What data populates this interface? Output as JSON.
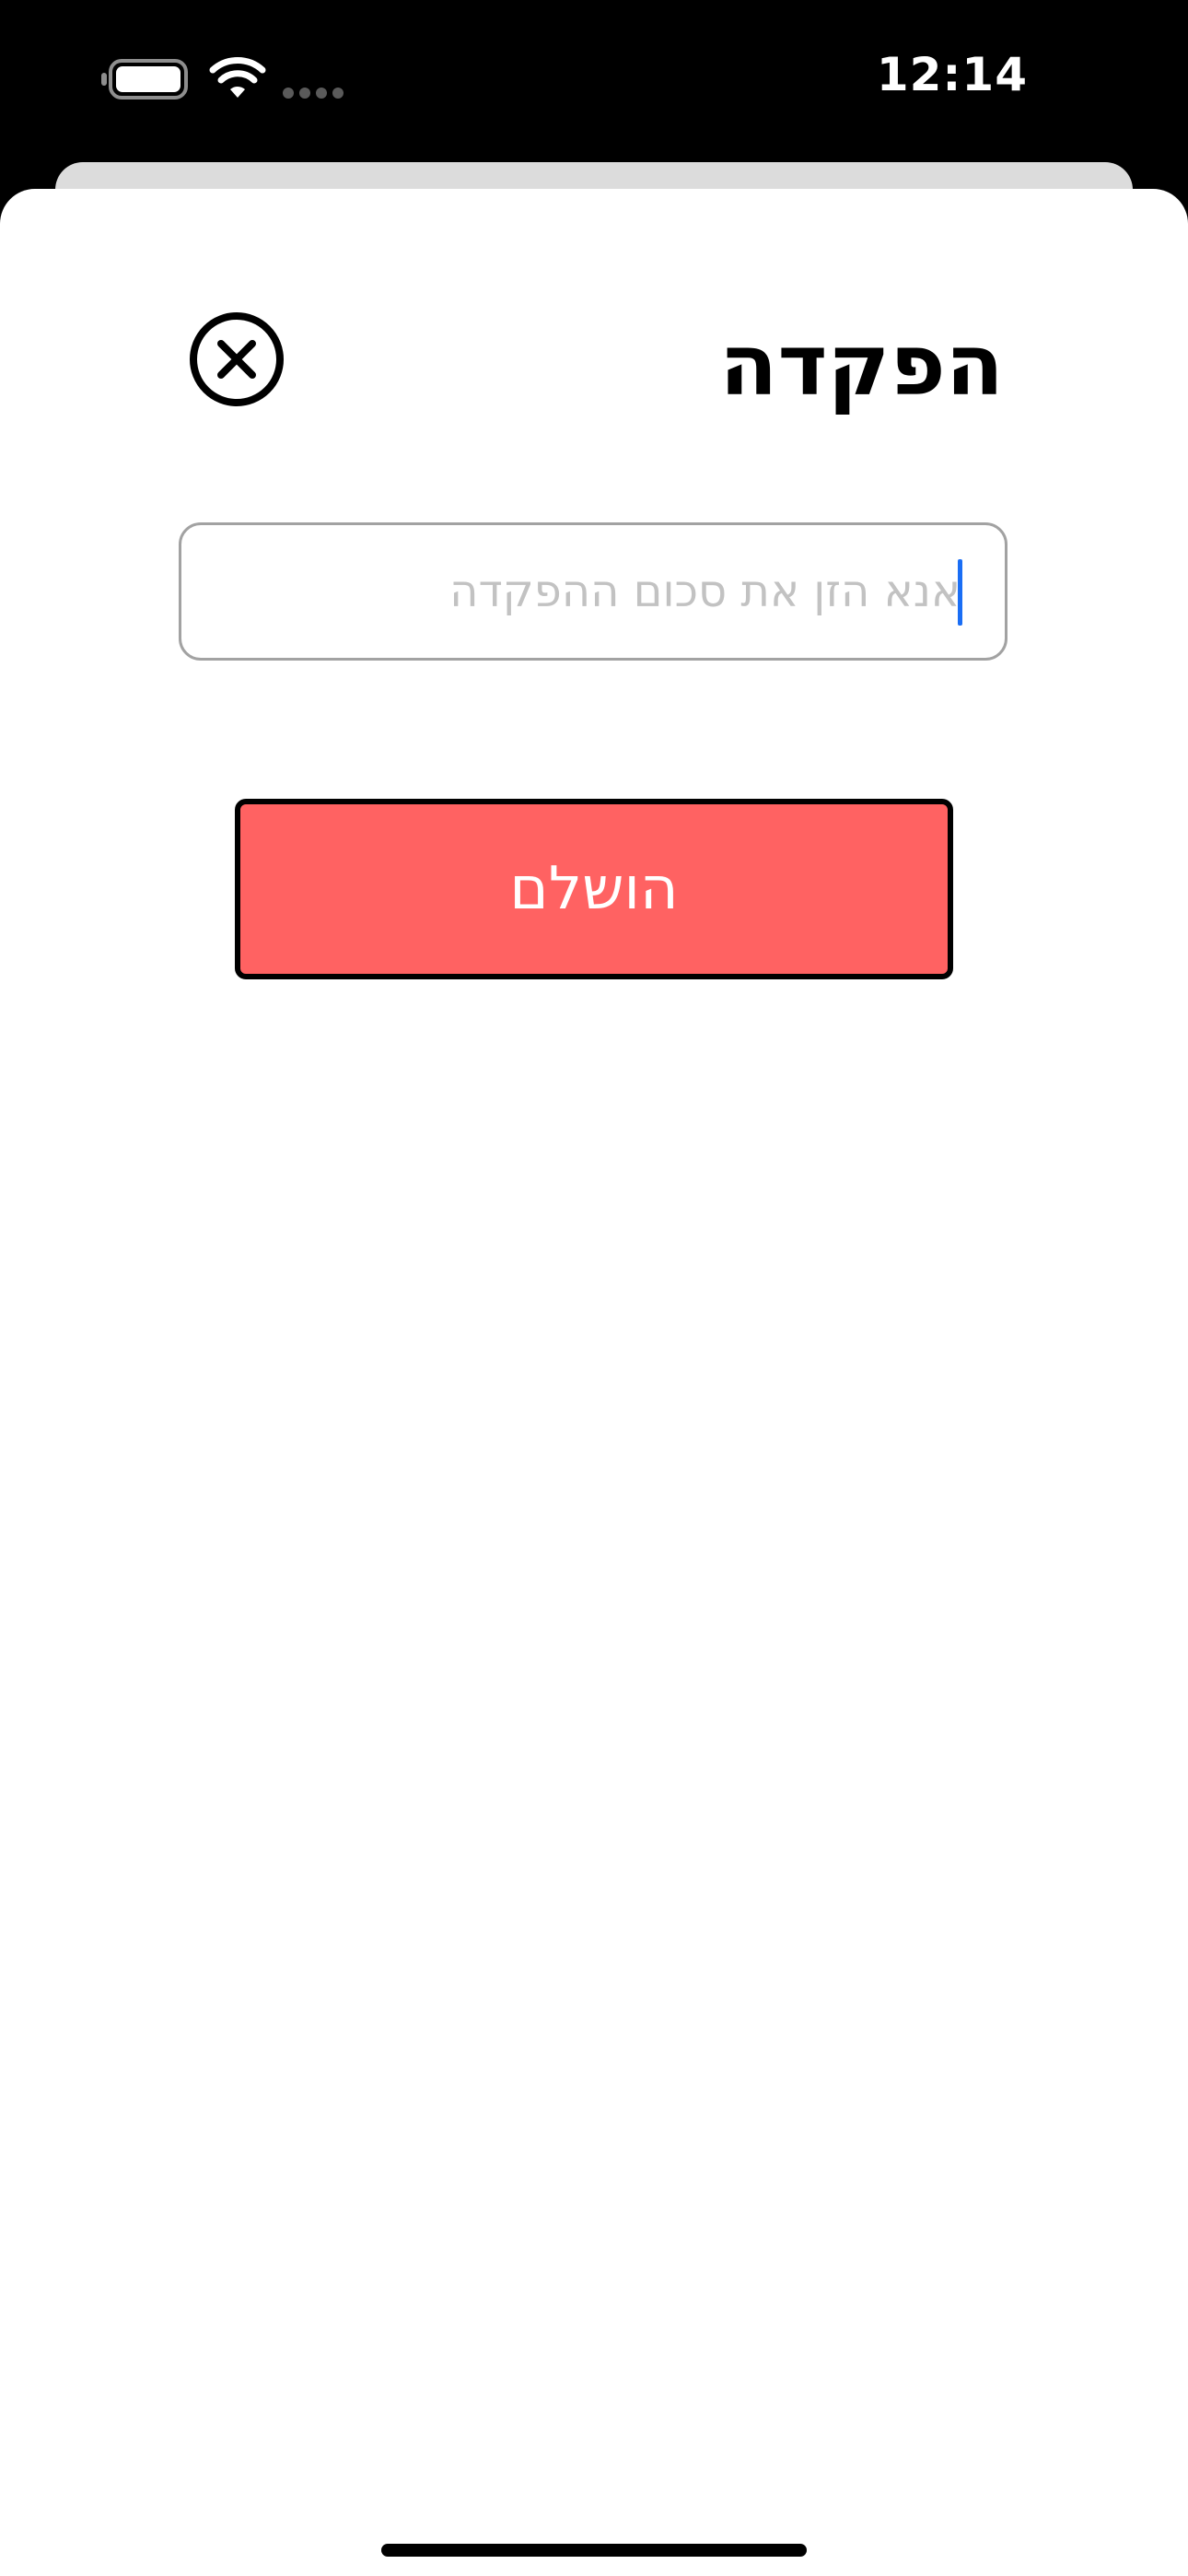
{
  "status_bar": {
    "time": "12:14",
    "icons": [
      "battery-icon",
      "wifi-icon",
      "signal-dots-icon"
    ]
  },
  "sheet": {
    "title": "הפקדה",
    "close_icon": "close-circle-icon",
    "amount_field": {
      "value": "",
      "placeholder": "אנא הזן את סכום ההפקדה"
    },
    "complete_button_label": "הושלם"
  },
  "colors": {
    "button": "#ff6262",
    "caret": "#1a6ef5",
    "placeholder": "#c2c2c2",
    "field_border": "#a2a2a2"
  }
}
